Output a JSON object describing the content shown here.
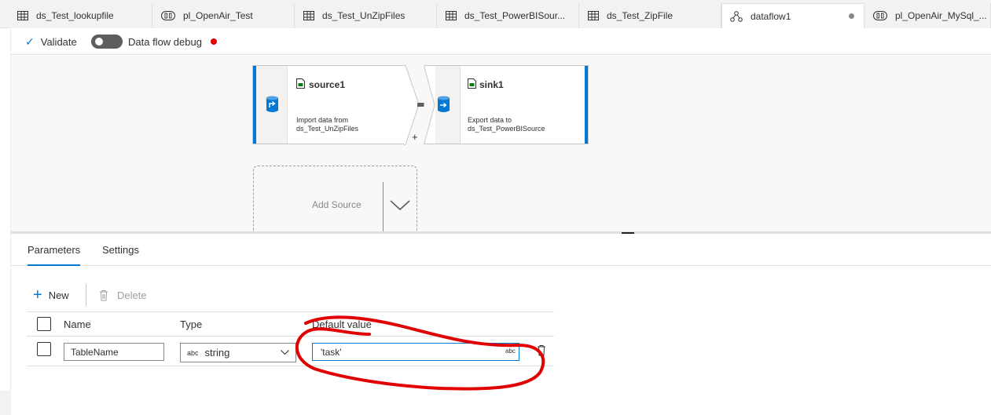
{
  "tabs": [
    {
      "label": "ds_Test_lookupfile",
      "icon": "table-icon"
    },
    {
      "label": "pl_OpenAir_Test",
      "icon": "pipeline-icon"
    },
    {
      "label": "ds_Test_UnZipFiles",
      "icon": "table-icon"
    },
    {
      "label": "ds_Test_PowerBISour...",
      "icon": "table-icon"
    },
    {
      "label": "ds_Test_ZipFile",
      "icon": "table-icon"
    },
    {
      "label": "dataflow1",
      "icon": "dataflow-icon",
      "active": true,
      "unsaved": true
    },
    {
      "label": "pl_OpenAir_MySql_...",
      "icon": "pipeline-icon"
    }
  ],
  "toolbar": {
    "validate_label": "Validate",
    "debug_label": "Data flow debug",
    "debug_on": false
  },
  "canvas": {
    "source": {
      "title": "source1",
      "desc_line1": "Import data from",
      "desc_line2": "ds_Test_UnZipFiles",
      "plus": "+"
    },
    "sink": {
      "title": "sink1",
      "desc_line1": "Export data to",
      "desc_line2": "ds_Test_PowerBISource"
    },
    "add_source_label": "Add Source"
  },
  "panel": {
    "tabs": [
      "Parameters",
      "Settings"
    ],
    "active_tab": "Parameters",
    "commands": {
      "new_label": "New",
      "delete_label": "Delete"
    },
    "columns": [
      "Name",
      "Type",
      "Default value"
    ],
    "rows": [
      {
        "name": "TableName",
        "type_prefix": "abc",
        "type": "string",
        "default_value": "'task'",
        "default_suffix": "abc"
      }
    ]
  },
  "colors": {
    "accent": "#0078d4",
    "debug_status": "#e00000",
    "annotation": "#e00000"
  }
}
